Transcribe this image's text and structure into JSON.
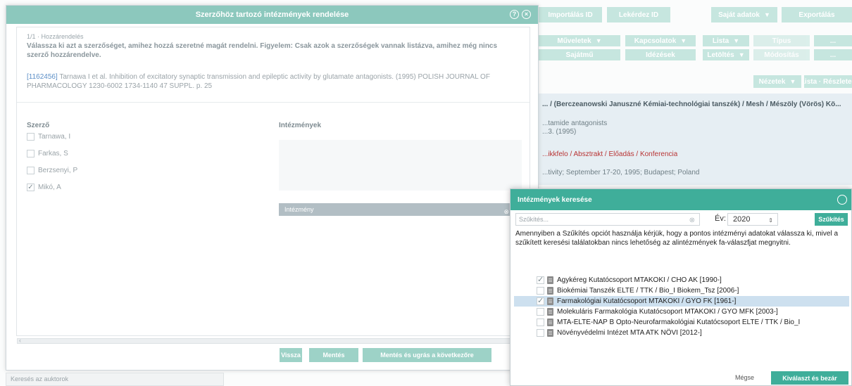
{
  "app": {
    "toolbar_row1": [
      {
        "label": "Importálás ID",
        "caret": false
      },
      {
        "label": "Lekérdez ID",
        "caret": false
      },
      {
        "label": "Saját adatok",
        "caret": true
      },
      {
        "label": "Exportálás",
        "caret": false
      }
    ],
    "toolbar_row2": [
      {
        "label": "Műveletek",
        "caret": true
      },
      {
        "label": "Kapcsolatok",
        "caret": true
      },
      {
        "label": "Lista",
        "caret": true
      },
      {
        "label": "Típus",
        "caret": false
      },
      {
        "label": "...",
        "caret": false
      }
    ],
    "toolbar_row3": [
      {
        "label": "Sajátmű",
        "caret": false
      },
      {
        "label": "Idézések",
        "caret": false
      },
      {
        "label": "Letöltés",
        "caret": true
      },
      {
        "label": "Módosítás",
        "caret": false
      },
      {
        "label": "...",
        "caret": false
      }
    ],
    "view_buttons": [
      {
        "label": "Nézetek",
        "caret": true
      },
      {
        "label": "Lista · Részletes",
        "caret": false
      }
    ],
    "bg_record": {
      "authors_line": "... / (Berczeanowski Januszné Kémiai-technológiai tanszék) / Mesh / Mészöly (Vörös) Kö...",
      "title_line": "...tamide antagonists",
      "meta_line": "...3. (1995)",
      "links_line": "...ikkfelo / Absztrakt / Előadás / Konferencia",
      "conf_line": "...tivity; September 17-20, 1995; Budapest; Poland"
    },
    "status_search_placeholder": "Keresés az auktorok"
  },
  "dialog1": {
    "title": "Szerzőhöz tartozó intézmények rendelése",
    "breadcrumb": "1/1 · Hozzárendelés",
    "instruction": "Válassza ki azt a szerzőséget, amihez hozzá szeretné magát rendelni. Figyelem: Csak azok a szerzőségek vannak listázva, amihez még nincs szerző hozzárendelve.",
    "citation_id": "[1162456]",
    "citation_text": " Tarnawa I et al. Inhibition of excitatory synaptic transmission and epileptic activity by glutamate antagonists. (1995) POLISH JOURNAL OF PHARMACOLOGY 1230-6002 1734-1140 47 SUPPL. p. 25",
    "col_author": "Szerző",
    "col_institutions": "Intézmények",
    "authors": [
      {
        "name": "Tarnawa, I",
        "checked": false
      },
      {
        "name": "Farkas, S",
        "checked": false
      },
      {
        "name": "Berzsenyi, P",
        "checked": false
      },
      {
        "name": "Mikó, A",
        "checked": true
      }
    ],
    "selected_institution": "Intézmény",
    "buttons": {
      "back": "Vissza",
      "save": "Mentés",
      "save_next": "Mentés és ugrás a következőre"
    }
  },
  "dialog2": {
    "title": "Intézmények keresése",
    "filter_placeholder": "Szűkítés...",
    "year_label": "Év:",
    "year_value": "2020",
    "filter_button": "Szűkítés",
    "note": "Amennyiben a Szűkítés opciót használja kérjük, hogy a pontos intézményi adatokat válassza ki, mivel a szűkített keresési találatokban nincs lehetőség az alintézmények fa-válaszfjat megnyitni.",
    "tree": [
      {
        "label": "Agykéreg Kutatócsoport MTAKOKI / CHO AK [1990-]",
        "checked": true,
        "selected": false
      },
      {
        "label": "Biokémiai Tanszék ELTE / TTK / Bio_I Biokem_Tsz [2006-]",
        "checked": false,
        "selected": false
      },
      {
        "label": "Farmakológiai Kutatócsoport MTAKOKI / GYO FK [1961-]",
        "checked": true,
        "selected": true
      },
      {
        "label": "Molekuláris Farmakológia Kutatócsoport MTAKOKI / GYO MFK [2003-]",
        "checked": false,
        "selected": false
      },
      {
        "label": "MTA-ELTE-NAP B Opto-Neurofarmakológiai Kutatócsoport ELTE / TTK / Bio_I",
        "checked": false,
        "selected": false
      },
      {
        "label": "Növényvédelmi Intézet MTA ATK NÖVI [2012-]",
        "checked": false,
        "selected": false
      }
    ],
    "cancel": "Mégse",
    "select_close": "Kiválaszt és bezár"
  },
  "colors": {
    "accent": "#3fae9a",
    "accent_light": "#8cc8bd",
    "selected_row": "#cde0ef"
  }
}
